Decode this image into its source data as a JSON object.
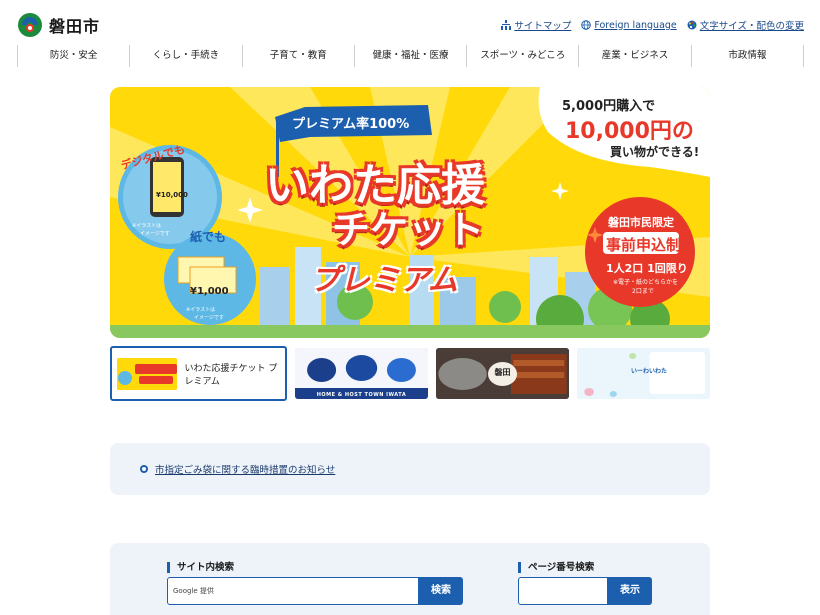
{
  "header": {
    "site_name": "磐田市",
    "util_links": [
      {
        "label": "サイトマップ",
        "icon": "sitemap-icon"
      },
      {
        "label": "Foreign language",
        "icon": "globe-icon"
      },
      {
        "label": "文字サイズ・配色の変更",
        "icon": "palette-icon"
      }
    ]
  },
  "nav": {
    "items": [
      "防災・安全",
      "くらし・手続き",
      "子育て・教育",
      "健康・福祉・医療",
      "スポーツ・みどころ",
      "産業・ビジネス",
      "市政情報"
    ]
  },
  "hero": {
    "ribbon": "プレミアム率100%",
    "title_line1": "いわた応援",
    "title_line2": "チケット",
    "title_line3": "プレミアム",
    "offer_line1": "5,000円購入で",
    "offer_line2": "10,000円の",
    "offer_line3": "買い物ができる!",
    "badge_line1": "磐田市民限定",
    "badge_line2": "事前申込制",
    "badge_line3": "1人2口 1回限り",
    "badge_line4": "※電子・紙のどちらかを",
    "badge_line5": "2口まで",
    "digital_label": "デジタルでも",
    "paper_label": "紙でも",
    "digital_amount": "¥10,000",
    "paper_amount": "¥1,000",
    "note1": "※イラストは",
    "note2": "イメージです",
    "colors": {
      "yellow": "#ffd90a",
      "red": "#e8382a",
      "blue": "#1c5fae",
      "green": "#3aa846"
    }
  },
  "carousel": {
    "active_caption": "いわた応援チケット プレミアム",
    "slide2_text": "HOME & HOST TOWN IWATA",
    "slide3_text": "磐田",
    "slide4_text": "いーわいわた"
  },
  "notice": {
    "link": "市指定ごみ袋に関する臨時措置のお知らせ"
  },
  "search": {
    "site_label": "サイト内検索",
    "site_placeholder": "Google 提供",
    "site_button": "検索",
    "page_label": "ページ番号検索",
    "page_placeholder": "",
    "page_button": "表示"
  }
}
